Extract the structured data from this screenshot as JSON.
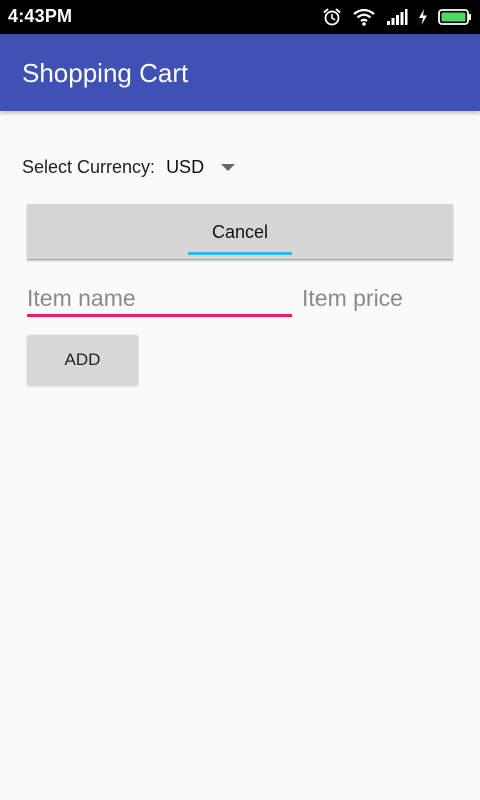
{
  "status_bar": {
    "time": "4:43PM",
    "icons": [
      "alarm-icon",
      "wifi-icon",
      "signal-icon",
      "charging-icon",
      "battery-icon"
    ],
    "battery_color": "#4cd964"
  },
  "app_bar": {
    "title": "Shopping Cart",
    "color": "#3f51b5"
  },
  "currency": {
    "label": "Select Currency:",
    "selected": "USD"
  },
  "cancel_button": {
    "label": "Cancel",
    "indicator_color": "#33b5e5"
  },
  "item_form": {
    "item_name": {
      "value": "",
      "placeholder": "Item name",
      "focused": true,
      "accent_color": "#e91e63"
    },
    "item_price": {
      "value": "",
      "placeholder": "Item price"
    },
    "add_label": "ADD"
  }
}
